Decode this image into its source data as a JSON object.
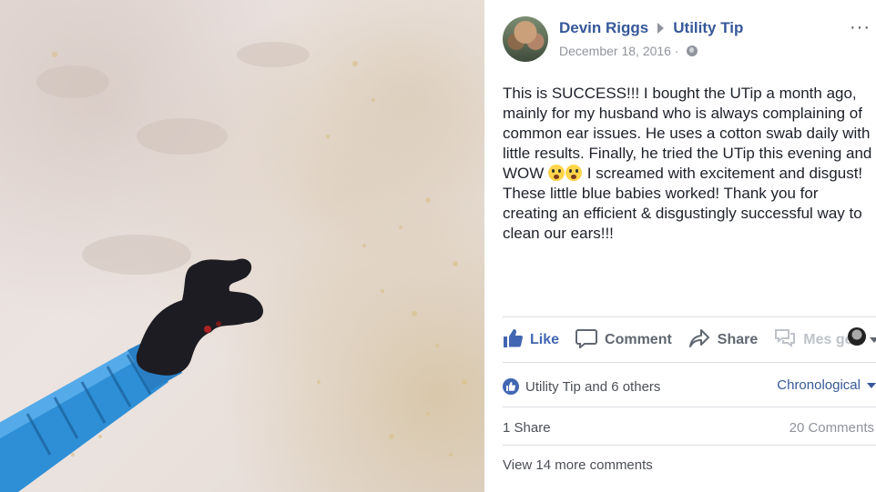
{
  "post": {
    "author": "Devin Riggs",
    "page": "Utility Tip",
    "date": "December 18, 2016 ·",
    "more_label": "···",
    "text_parts": [
      "This is SUCCESS!!! I bought the UTip a month ago, mainly for my husband who is always complaining of common ear issues. He uses a cotton swab daily with little results. Finally, he tried the UTip this evening and WOW ",
      " I screamed with excitement and disgust! These little blue babies worked! Thank you for creating an efficient & disgustingly successful way to clean our ears!!!"
    ],
    "emojis": [
      "astonished-face-emoji",
      "flushed-face-emoji"
    ]
  },
  "actions": {
    "like": "Like",
    "comment": "Comment",
    "share": "Share",
    "message": "Mes  ge"
  },
  "reactions": {
    "reactors": "Utility Tip and 6 others",
    "order": "Chronological"
  },
  "counts": {
    "shares": "1 Share",
    "comments": "20 Comments"
  },
  "view_more": "View 14 more comments",
  "colors": {
    "link": "#365899",
    "like_blue": "#4267b2",
    "text": "#1d2129",
    "muted": "#90949c",
    "tool_blue": "#2e8fd6"
  },
  "photo": {
    "subject": "blue-ear-tool-with-earwax"
  }
}
